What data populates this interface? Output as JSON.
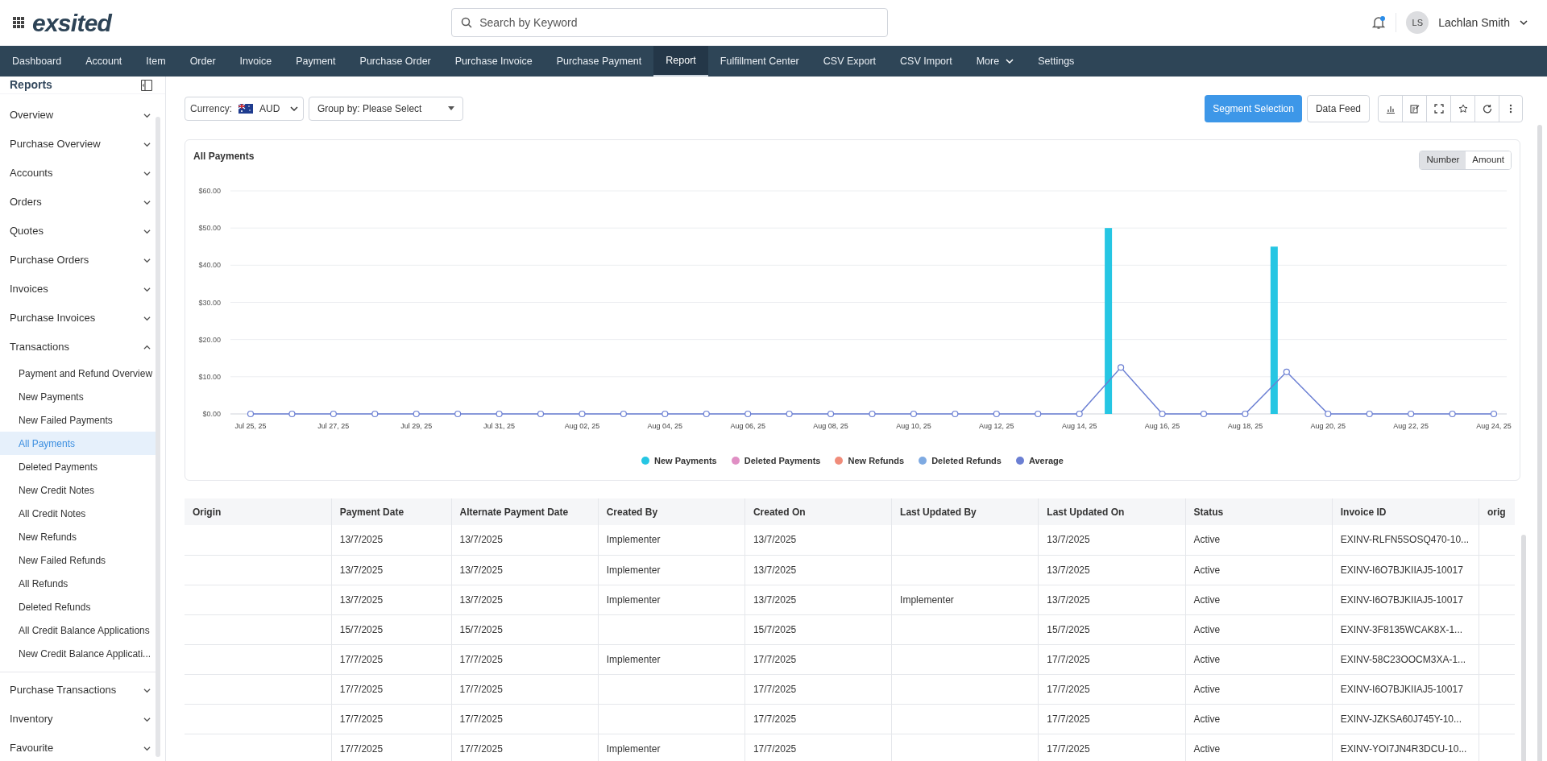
{
  "header": {
    "logo": "exsited",
    "search": {
      "placeholder": "Search by Keyword"
    },
    "user": {
      "initials": "LS",
      "name": "Lachlan Smith"
    },
    "notifications": {
      "unread": true
    }
  },
  "nav": [
    {
      "label": "Dashboard",
      "kind": "link",
      "selected": false
    },
    {
      "label": "Account",
      "kind": "link",
      "selected": false
    },
    {
      "label": "Item",
      "kind": "link",
      "selected": false
    },
    {
      "label": "Order",
      "kind": "link",
      "selected": false
    },
    {
      "label": "Invoice",
      "kind": "link",
      "selected": false
    },
    {
      "label": "Payment",
      "kind": "link",
      "selected": false
    },
    {
      "label": "Purchase Order",
      "kind": "link",
      "selected": false
    },
    {
      "label": "Purchase Invoice",
      "kind": "link",
      "selected": false
    },
    {
      "label": "Purchase Payment",
      "kind": "link",
      "selected": false
    },
    {
      "label": "Report",
      "kind": "link",
      "selected": true
    },
    {
      "label": "Fulfillment Center",
      "kind": "link",
      "selected": false
    },
    {
      "label": "CSV Export",
      "kind": "link",
      "selected": false
    },
    {
      "label": "CSV Import",
      "kind": "link",
      "selected": false
    },
    {
      "label": "More",
      "kind": "menu",
      "selected": false
    },
    {
      "label": "Settings",
      "kind": "link",
      "selected": false
    }
  ],
  "sidebar": {
    "title": "Reports",
    "items": [
      {
        "label": "Overview",
        "expanded": false
      },
      {
        "label": "Purchase Overview",
        "expanded": false
      },
      {
        "label": "Accounts",
        "expanded": false
      },
      {
        "label": "Orders",
        "expanded": false
      },
      {
        "label": "Quotes",
        "expanded": false
      },
      {
        "label": "Purchase Orders",
        "expanded": false
      },
      {
        "label": "Invoices",
        "expanded": false
      },
      {
        "label": "Purchase Invoices",
        "expanded": false
      },
      {
        "label": "Transactions",
        "expanded": true,
        "children": [
          {
            "label": "Payment and Refund Overview",
            "selected": false
          },
          {
            "label": "New Payments",
            "selected": false
          },
          {
            "label": "New Failed Payments",
            "selected": false
          },
          {
            "label": "All Payments",
            "selected": true
          },
          {
            "label": "Deleted Payments",
            "selected": false
          },
          {
            "label": "New Credit Notes",
            "selected": false
          },
          {
            "label": "All Credit Notes",
            "selected": false
          },
          {
            "label": "New Refunds",
            "selected": false
          },
          {
            "label": "New Failed Refunds",
            "selected": false
          },
          {
            "label": "All Refunds",
            "selected": false
          },
          {
            "label": "Deleted Refunds",
            "selected": false
          },
          {
            "label": "All Credit Balance Applications",
            "selected": false
          },
          {
            "label": "New Credit Balance Applicati...",
            "selected": false
          }
        ]
      },
      {
        "label": "Purchase Transactions",
        "expanded": false
      },
      {
        "label": "Inventory",
        "expanded": false
      },
      {
        "label": "Favourite",
        "expanded": false
      }
    ]
  },
  "toolbar": {
    "currency_label": "Currency:",
    "currency": "AUD",
    "group_by": "Group by: Please Select",
    "buttons": [
      "Segment Selection",
      "Data Feed"
    ]
  },
  "chart_card": {
    "title": "All Payments",
    "toggle": [
      {
        "label": "Number",
        "selected": true
      },
      {
        "label": "Amount",
        "selected": false
      }
    ],
    "chart_data": {
      "type": "bar",
      "grid": true,
      "categories": [
        "Jul 25, 25",
        null,
        "Jul 27, 25",
        null,
        "Jul 29, 25",
        null,
        "Jul 31, 25",
        null,
        "Aug 02, 25",
        null,
        "Aug 04, 25",
        null,
        "Aug 06, 25",
        null,
        "Aug 08, 25",
        null,
        "Aug 10, 25",
        null,
        "Aug 12, 25",
        null,
        "Aug 14, 25",
        null,
        "Aug 16, 25",
        null,
        "Aug 18, 25",
        null,
        "Aug 20, 25",
        null,
        "Aug 22, 25",
        null,
        "Aug 24, 25"
      ],
      "ylim": [
        0,
        60
      ],
      "yticks": [
        {
          "value": 0,
          "label": "$0.00"
        },
        {
          "value": 10,
          "label": "$10.00"
        },
        {
          "value": 20,
          "label": "$20.00"
        },
        {
          "value": 30,
          "label": "$30.00"
        },
        {
          "value": 40,
          "label": "$40.00"
        },
        {
          "value": 50,
          "label": "$50.00"
        },
        {
          "value": 60,
          "label": "$60.00"
        }
      ],
      "series": [
        {
          "name": "New Payments",
          "color": "#26c6e3",
          "values": [
            0,
            0,
            0,
            0,
            0,
            0,
            0,
            0,
            0,
            0,
            0,
            0,
            0,
            0,
            0,
            0,
            0,
            0,
            0,
            0,
            0,
            50,
            0,
            0,
            0,
            45,
            0,
            0,
            0,
            0,
            0
          ]
        },
        {
          "name": "Deleted Payments",
          "color": "#e08fc4",
          "values": [
            0,
            0,
            0,
            0,
            0,
            0,
            0,
            0,
            0,
            0,
            0,
            0,
            0,
            0,
            0,
            0,
            0,
            0,
            0,
            0,
            0,
            0,
            0,
            0,
            0,
            0,
            0,
            0,
            0,
            0,
            0
          ]
        },
        {
          "name": "New Refunds",
          "color": "#f08c7a",
          "values": [
            0,
            0,
            0,
            0,
            0,
            0,
            0,
            0,
            0,
            0,
            0,
            0,
            0,
            0,
            0,
            0,
            0,
            0,
            0,
            0,
            0,
            0,
            0,
            0,
            0,
            0,
            0,
            0,
            0,
            0,
            0
          ]
        },
        {
          "name": "Deleted Refunds",
          "color": "#7eaae2",
          "values": [
            0,
            0,
            0,
            0,
            0,
            0,
            0,
            0,
            0,
            0,
            0,
            0,
            0,
            0,
            0,
            0,
            0,
            0,
            0,
            0,
            0,
            0,
            0,
            0,
            0,
            0,
            0,
            0,
            0,
            0,
            0
          ]
        },
        {
          "name": "Average",
          "color": "#6b7fd3",
          "type": "line",
          "marker": "circle",
          "values": [
            0,
            0,
            0,
            0,
            0,
            0,
            0,
            0,
            0,
            0,
            0,
            0,
            0,
            0,
            0,
            0,
            0,
            0,
            0,
            0,
            0,
            12.5,
            0,
            0,
            0,
            11.3,
            0,
            0,
            0,
            0,
            0
          ]
        }
      ]
    }
  },
  "table": {
    "columns": [
      "Origin",
      "Payment Date",
      "Alternate Payment Date",
      "Created By",
      "Created On",
      "Last Updated By",
      "Last Updated On",
      "Status",
      "Invoice ID",
      "orig"
    ],
    "rows": [
      [
        null,
        "13/7/2025",
        "13/7/2025",
        "Implementer",
        "13/7/2025",
        null,
        "13/7/2025",
        "Active",
        "EXINV-RLFN5SOSQ470-10...",
        null
      ],
      [
        null,
        "13/7/2025",
        "13/7/2025",
        "Implementer",
        "13/7/2025",
        null,
        "13/7/2025",
        "Active",
        "EXINV-I6O7BJKIIAJ5-10017",
        null
      ],
      [
        null,
        "13/7/2025",
        "13/7/2025",
        "Implementer",
        "13/7/2025",
        "Implementer",
        "13/7/2025",
        "Active",
        "EXINV-I6O7BJKIIAJ5-10017",
        null
      ],
      [
        null,
        "15/7/2025",
        "15/7/2025",
        null,
        "15/7/2025",
        null,
        "15/7/2025",
        "Active",
        "EXINV-3F8135WCAK8X-1...",
        null
      ],
      [
        null,
        "17/7/2025",
        "17/7/2025",
        "Implementer",
        "17/7/2025",
        null,
        "17/7/2025",
        "Active",
        "EXINV-58C23OOCM3XA-1...",
        null
      ],
      [
        null,
        "17/7/2025",
        "17/7/2025",
        null,
        "17/7/2025",
        null,
        "17/7/2025",
        "Active",
        "EXINV-I6O7BJKIIAJ5-10017",
        null
      ],
      [
        null,
        "17/7/2025",
        "17/7/2025",
        null,
        "17/7/2025",
        null,
        "17/7/2025",
        "Active",
        "EXINV-JZKSA60J745Y-10...",
        null
      ],
      [
        null,
        "17/7/2025",
        "17/7/2025",
        "Implementer",
        "17/7/2025",
        null,
        "17/7/2025",
        "Active",
        "EXINV-YOI7JN4R3DCU-10...",
        null
      ]
    ]
  }
}
